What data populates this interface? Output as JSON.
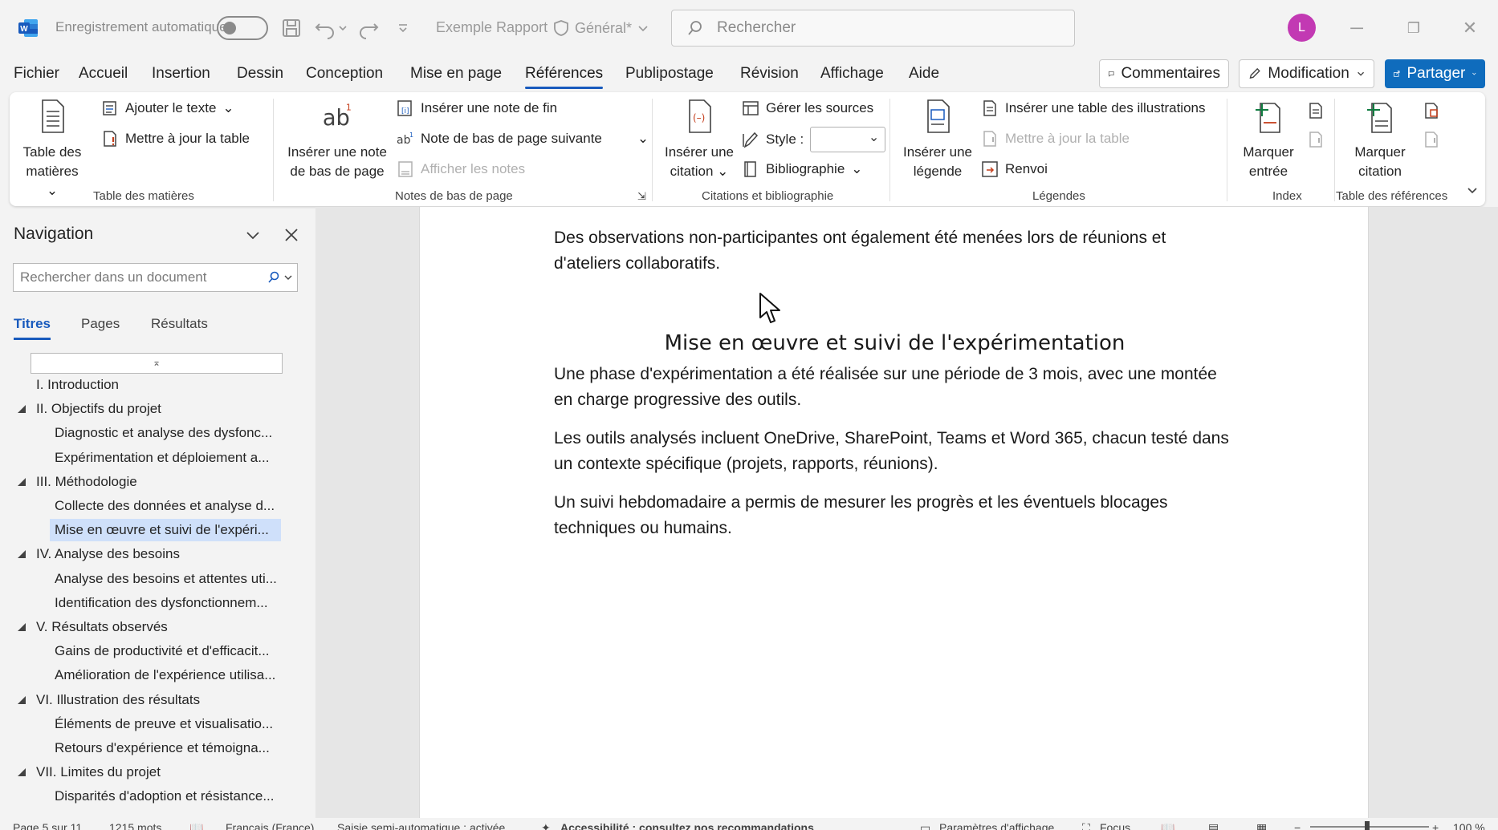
{
  "titlebar": {
    "autosave_label": "Enregistrement automatique",
    "doc_name": "Exemple Rapport",
    "sensitivity": "Général*",
    "search_placeholder": "Rechercher",
    "avatar_initial": "L"
  },
  "menu": {
    "tabs": [
      "Fichier",
      "Accueil",
      "Insertion",
      "Dessin",
      "Conception",
      "Mise en page",
      "Références",
      "Publipostage",
      "Révision",
      "Affichage",
      "Aide"
    ],
    "active_tab": "Références",
    "comments_label": "Commentaires",
    "mode_label": "Modification",
    "share_label": "Partager"
  },
  "ribbon": {
    "toc": {
      "group": "Table des matières",
      "big_line1": "Table des",
      "big_line2": "matières",
      "add_text": "Ajouter le texte",
      "update_table": "Mettre à jour la table"
    },
    "footnotes": {
      "group": "Notes de bas de page",
      "big_line1": "Insérer une note",
      "big_line2": "de bas de page",
      "endnote": "Insérer une note de fin",
      "next_footnote": "Note de bas de page suivante",
      "show_notes": "Afficher les notes"
    },
    "citations": {
      "group": "Citations et bibliographie",
      "big_line1": "Insérer une",
      "big_line2": "citation",
      "manage_sources": "Gérer les sources",
      "style_label": "Style :",
      "bibliography": "Bibliographie"
    },
    "captions": {
      "group": "Légendes",
      "big_line1": "Insérer une",
      "big_line2": "légende",
      "insert_tof": "Insérer une table des illustrations",
      "update_table": "Mettre à jour la table",
      "cross_ref": "Renvoi"
    },
    "index": {
      "group": "Index",
      "big_line1": "Marquer",
      "big_line2": "entrée"
    },
    "toa": {
      "group": "Table des références",
      "big_line1": "Marquer",
      "big_line2": "citation"
    }
  },
  "navigation": {
    "title": "Navigation",
    "search_placeholder": "Rechercher dans un document",
    "tabs": [
      "Titres",
      "Pages",
      "Résultats"
    ],
    "items": [
      {
        "text": "I. Introduction",
        "level": 1,
        "expand": false
      },
      {
        "text": "II. Objectifs du projet",
        "level": 1,
        "expand": true
      },
      {
        "text": "Diagnostic et analyse des dysfonc...",
        "level": 2
      },
      {
        "text": "Expérimentation et déploiement a...",
        "level": 2
      },
      {
        "text": "III. Méthodologie",
        "level": 1,
        "expand": true
      },
      {
        "text": "Collecte des données et analyse d...",
        "level": 2
      },
      {
        "text": "Mise en œuvre et suivi de l'expéri...",
        "level": 2,
        "selected": true
      },
      {
        "text": "IV. Analyse des besoins",
        "level": 1,
        "expand": true
      },
      {
        "text": "Analyse des besoins et attentes uti...",
        "level": 2
      },
      {
        "text": "Identification des dysfonctionnem...",
        "level": 2
      },
      {
        "text": "V. Résultats observés",
        "level": 1,
        "expand": true
      },
      {
        "text": "Gains de productivité et d'efficacit...",
        "level": 2
      },
      {
        "text": "Amélioration de l'expérience utilisa...",
        "level": 2
      },
      {
        "text": "VI. Illustration des résultats",
        "level": 1,
        "expand": true
      },
      {
        "text": "Éléments de preuve et visualisatio...",
        "level": 2
      },
      {
        "text": "Retours d'expérience et témoigna...",
        "level": 2
      },
      {
        "text": "VII. Limites du projet",
        "level": 1,
        "expand": true
      },
      {
        "text": "Disparités d'adoption et résistance...",
        "level": 2
      }
    ]
  },
  "document": {
    "para0": "Des observations non-participantes ont également été menées lors de réunions et d'ateliers collaboratifs.",
    "heading": "Mise en œuvre et suivi de l'expérimentation",
    "para1": "Une phase d'expérimentation a été réalisée sur une période de 3 mois, avec une montée en charge progressive des outils.",
    "para2": "Les outils analysés incluent OneDrive, SharePoint, Teams et Word 365, chacun testé dans un contexte spécifique (projets, rapports, réunions).",
    "para3": "Un suivi hebdomadaire a permis de mesurer les progrès et les éventuels blocages techniques ou humains."
  },
  "statusbar": {
    "page": "Page 5 sur 11",
    "words": "1215 mots",
    "language": "Français (France)",
    "autocomplete": "Saisie semi-automatique : activée",
    "accessibility": "Accessibilité : consultez nos recommandations",
    "display_settings": "Paramètres d'affichage",
    "focus": "Focus",
    "zoom": "100 %"
  }
}
